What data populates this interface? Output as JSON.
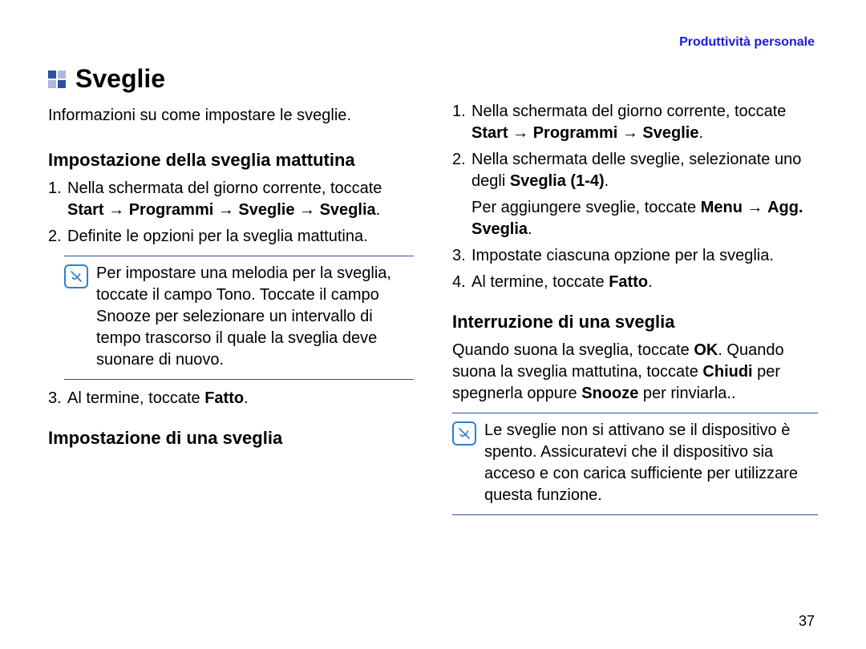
{
  "header": {
    "section_link": "Produttività personale"
  },
  "title": "Sveglie",
  "intro": "Informazioni su come impostare le sveglie.",
  "left": {
    "h1": "Impostazione della sveglia mattutina",
    "s1_pre": "Nella schermata del giorno corrente, toccate ",
    "s1_b1": "Start",
    "s1_arrow": " → ",
    "s1_b2": "Programmi",
    "s1_b3": "Sveglie",
    "s1_b4": "Sveglia",
    "s1_dot": ".",
    "s2": "Definite le opzioni per la sveglia mattutina.",
    "note1": "Per impostare una melodia per la sveglia, toccate il campo Tono. Toccate il campo Snooze per selezionare un intervallo di tempo trascorso il quale la sveglia deve suonare di nuovo.",
    "s3_pre": "Al termine, toccate ",
    "s3_b": "Fatto",
    "h2": "Impostazione di una sveglia"
  },
  "right": {
    "r1_pre": "Nella schermata del giorno corrente, toccate ",
    "r1_b1": "Start",
    "r1_arrow": " → ",
    "r1_b2": "Programmi",
    "r1_b3": "Sveglie",
    "r1_dot": ".",
    "r2_pre": "Nella schermata delle sveglie, selezionate uno degli ",
    "r2_b": "Sveglia (1-4)",
    "r2_add_pre": "Per aggiungere sveglie, toccate ",
    "r2_add_b1": "Menu",
    "r2_add_b2": "Agg. Sveglia",
    "r3": "Impostate ciascuna opzione per la sveglia.",
    "r4_pre": "Al termine, toccate ",
    "r4_b": "Fatto",
    "h3": "Interruzione di una sveglia",
    "p_pre": "Quando suona la sveglia, toccate ",
    "p_b1": "OK",
    "p_mid1": ". Quando suona la sveglia mattutina, toccate ",
    "p_b2": "Chiudi",
    "p_mid2": " per spegnerla oppure ",
    "p_b3": "Snooze",
    "p_end": " per rinviarla..",
    "note2": "Le sveglie non si attivano se il dispositivo è spento. Assicuratevi che il dispositivo sia acceso e con carica sufficiente per utilizzare questa funzione."
  },
  "page_number": "37",
  "labels": {
    "n1": "1.",
    "n2": "2.",
    "n3": "3.",
    "n4": "4."
  }
}
